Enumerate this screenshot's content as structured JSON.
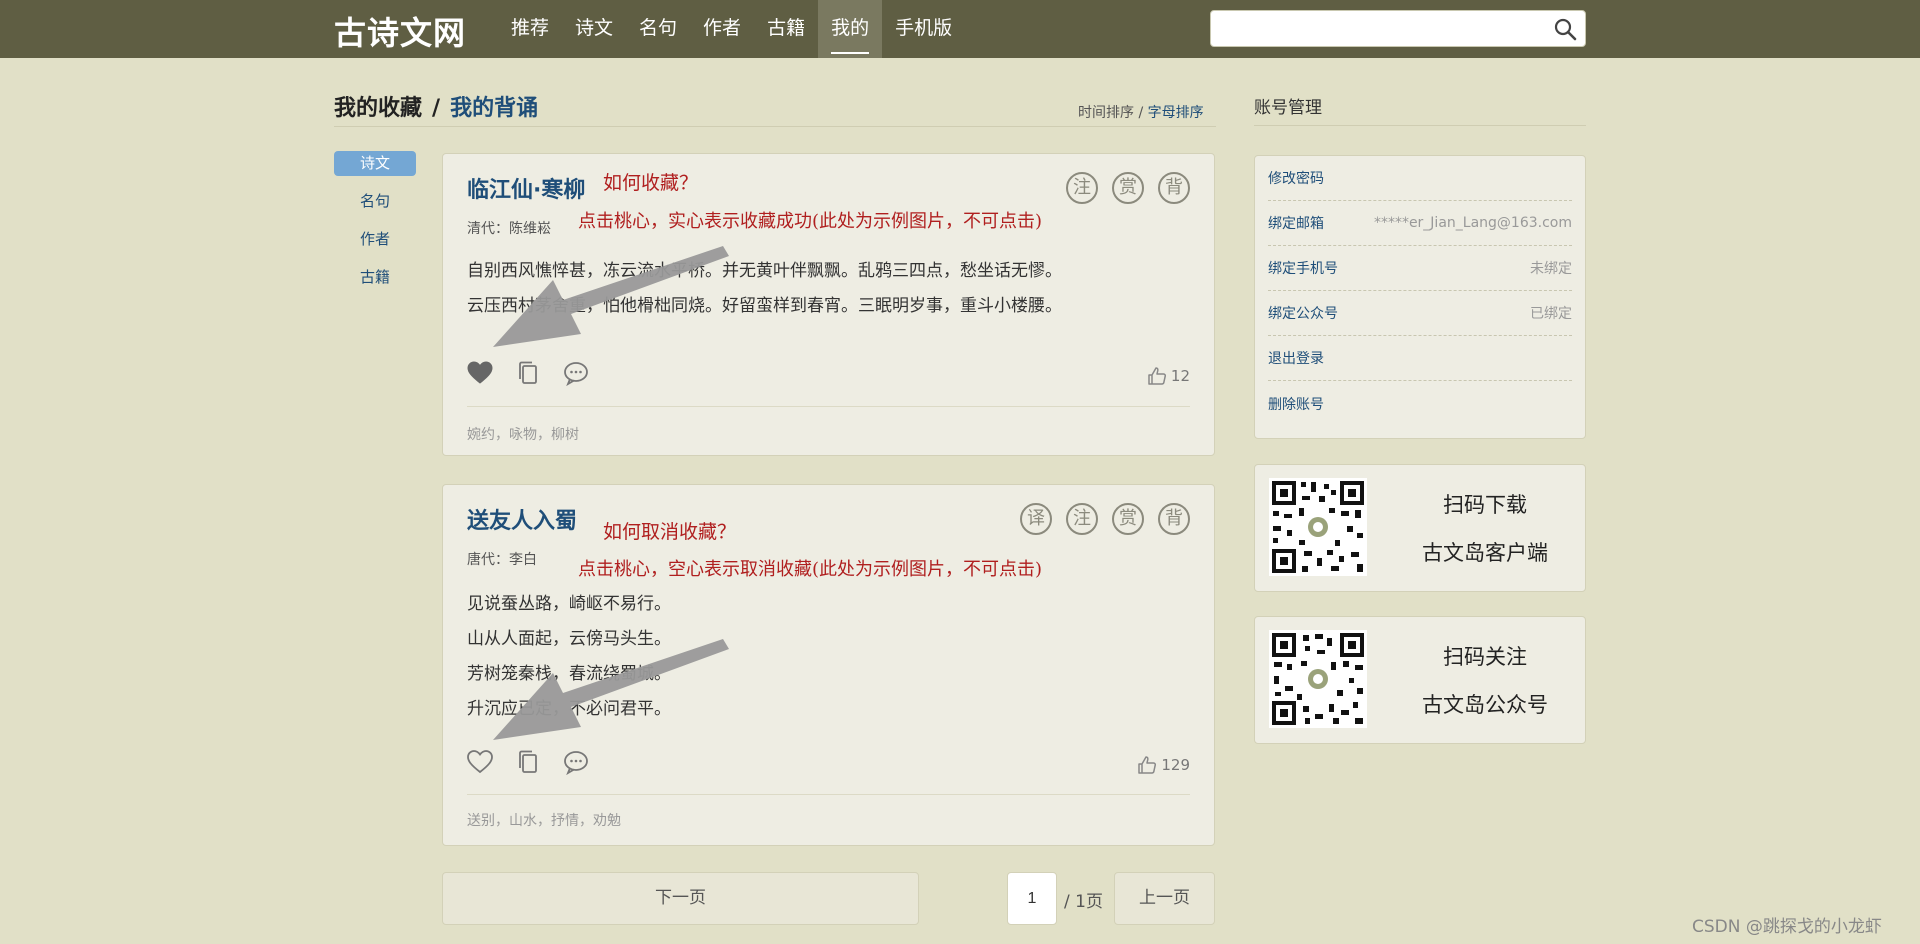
{
  "header": {
    "logo": "古诗文网",
    "nav": [
      "推荐",
      "诗文",
      "名句",
      "作者",
      "古籍",
      "我的",
      "手机版"
    ],
    "active_nav_index": 5,
    "search_value": "",
    "search_icon": "search-icon"
  },
  "main": {
    "title_favorites": "我的收藏",
    "title_sep": "/",
    "title_recite": "我的背诵",
    "sort_time": "时间排序",
    "sort_sep": "/",
    "sort_alpha": "字母排序"
  },
  "side_nav": [
    "诗文",
    "名句",
    "作者",
    "古籍"
  ],
  "cards": [
    {
      "title": "临江仙·寒柳",
      "author": "清代：陈维崧",
      "lines": [
        "自别西风憔悴甚，冻云流水平桥。并无黄叶伴飘飘。乱鸦三四点，愁坐话无憀。",
        "云压西村茅舍重，怕他榾柮同烧。好留蛮样到春宵。三眠明岁事，重斗小楼腰。"
      ],
      "seals": [
        "注",
        "赏",
        "背"
      ],
      "likes": "12",
      "tags": "婉约，咏物，柳树",
      "favorited": true,
      "note_question": "如何收藏？",
      "note_hint": "点击桃心，实心表示收藏成功(此处为示例图片，不可点击)"
    },
    {
      "title": "送友人入蜀",
      "author": "唐代：李白",
      "lines": [
        "见说蚕丛路，崎岖不易行。",
        "山从人面起，云傍马头生。",
        "芳树笼秦栈，春流绕蜀城。",
        "升沉应已定，不必问君平。"
      ],
      "seals": [
        "译",
        "注",
        "赏",
        "背"
      ],
      "likes": "129",
      "tags": "送别，山水，抒情，劝勉",
      "favorited": false,
      "note_question": "如何取消收藏？",
      "note_hint": "点击桃心，空心表示取消收藏(此处为示例图片，不可点击)"
    }
  ],
  "pagination": {
    "next_label": "下一页",
    "page_value": "1",
    "total_label": "/ 1页",
    "prev_label": "上一页"
  },
  "account": {
    "title": "账号管理",
    "rows": [
      {
        "label": "修改密码",
        "value": ""
      },
      {
        "label": "绑定邮箱",
        "value": "*****er_Jian_Lang@163.com"
      },
      {
        "label": "绑定手机号",
        "value": "未绑定"
      },
      {
        "label": "绑定公众号",
        "value": "已绑定"
      },
      {
        "label": "退出登录",
        "value": ""
      },
      {
        "label": "删除账号",
        "value": ""
      }
    ]
  },
  "qr": [
    {
      "line1": "扫码下载",
      "line2": "古文岛客户端"
    },
    {
      "line1": "扫码关注",
      "line2": "古文岛公众号"
    }
  ],
  "watermark": "CSDN @跳探戈的小龙虾",
  "colors": {
    "topbar": "#5f5e43",
    "page_bg": "#e1e0c7",
    "link_blue": "#1f4e79",
    "annotation_red": "#b01f1f"
  }
}
